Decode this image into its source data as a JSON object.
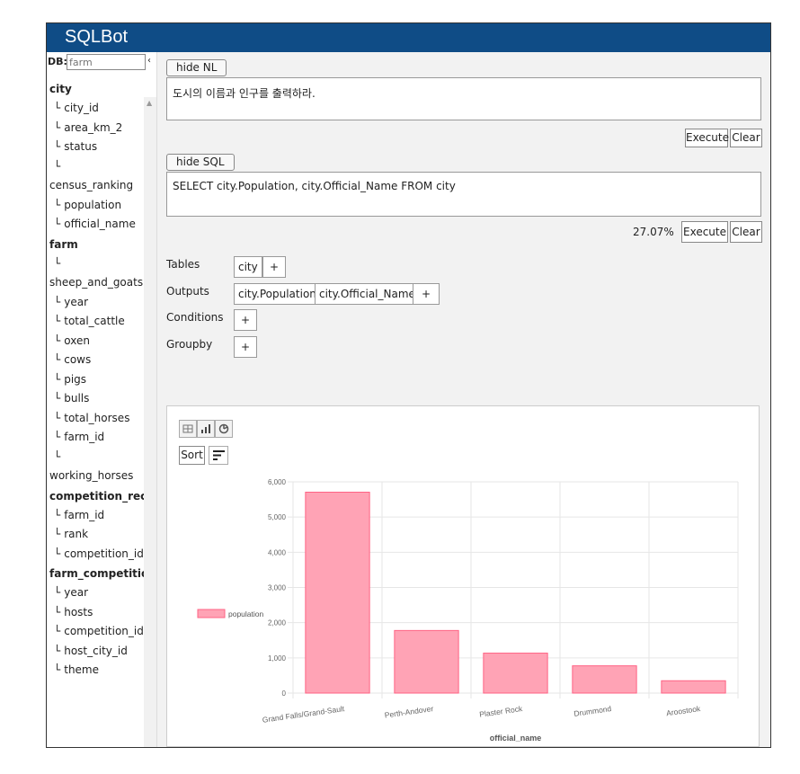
{
  "app": {
    "title": "SQLBot"
  },
  "sidebar": {
    "db_label": "DB:",
    "db_placeholder": "farm",
    "collapse_symbol": "‹",
    "tables": [
      {
        "name": "city",
        "columns": [
          "city_id",
          "area_km_2",
          "status",
          "census_ranking",
          "population",
          "official_name"
        ]
      },
      {
        "name": "farm",
        "columns": [
          "sheep_and_goats",
          "year",
          "total_cattle",
          "oxen",
          "cows",
          "pigs",
          "bulls",
          "total_horses",
          "farm_id",
          "working_horses"
        ]
      },
      {
        "name": "competition_record",
        "columns": [
          "farm_id",
          "rank",
          "competition_id"
        ]
      },
      {
        "name": "farm_competition",
        "columns": [
          "year",
          "hosts",
          "competition_id",
          "host_city_id",
          "theme"
        ]
      }
    ],
    "tree_prefix": "└"
  },
  "nl": {
    "toggle_label": "hide NL",
    "text": "도시의 이름과 인구를 출력하라.",
    "execute_label": "Execute",
    "clear_label": "Clear"
  },
  "sql": {
    "toggle_label": "hide SQL",
    "text": "SELECT city.Population, city.Official_Name FROM city",
    "confidence": "27.07%",
    "execute_label": "Execute",
    "clear_label": "Clear"
  },
  "builder": {
    "tables_label": "Tables",
    "tables": [
      "city"
    ],
    "outputs_label": "Outputs",
    "outputs": [
      "city.Population",
      "city.Official_Name"
    ],
    "conditions_label": "Conditions",
    "groupby_label": "Groupby",
    "add_symbol": "+"
  },
  "chart_controls": {
    "sort_label": "Sort",
    "icons": [
      "table-icon",
      "bar-chart-icon",
      "pie-chart-icon",
      "sort-lines-icon"
    ]
  },
  "chart_data": {
    "type": "bar",
    "categories": [
      "Grand Falls/Grand-Sault",
      "Perth-Andover",
      "Plaster Rock",
      "Drummond",
      "Aroostook"
    ],
    "series": [
      {
        "name": "population",
        "values": [
          5706,
          1778,
          1135,
          775,
          351
        ]
      }
    ],
    "xlabel": "official_name",
    "ylabel": "",
    "ylim": [
      0,
      6000
    ],
    "yticks": [
      "0",
      "1,000",
      "2,000",
      "3,000",
      "4,000",
      "5,000",
      "6,000"
    ],
    "grid": true,
    "legend_position": "left",
    "colors": {
      "fill": "#ffa3b5",
      "stroke": "#ff6384"
    }
  },
  "colors": {
    "header": "#0f4c86",
    "panel_bg": "#f2f2f2"
  }
}
